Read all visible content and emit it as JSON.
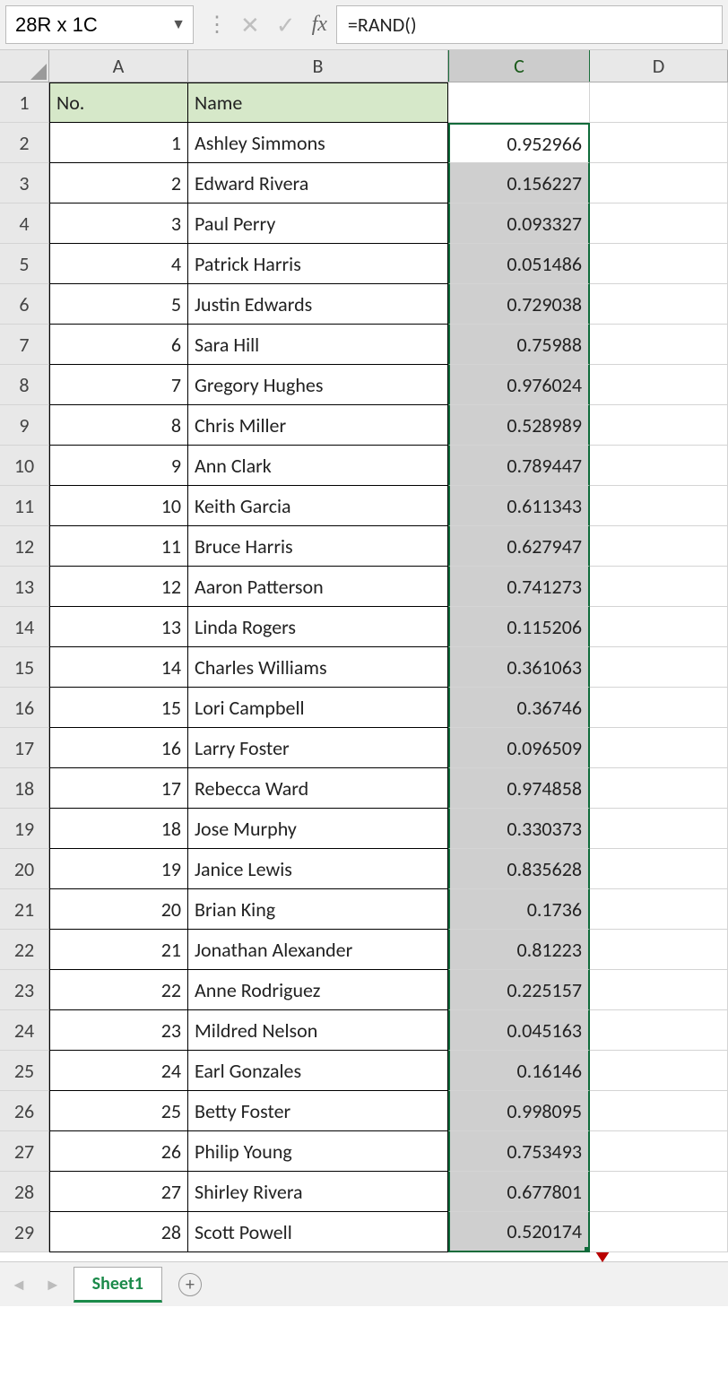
{
  "formula_bar": {
    "name_box": "28R x 1C",
    "fx_label": "fx",
    "formula": "=RAND()"
  },
  "columns": [
    "A",
    "B",
    "C",
    "D"
  ],
  "selected_column": "C",
  "header_row": {
    "A": "No.",
    "B": "Name",
    "C": ""
  },
  "rows": [
    {
      "r": 1,
      "A": "No.",
      "B": "Name",
      "C": ""
    },
    {
      "r": 2,
      "A": "1",
      "B": "Ashley Simmons",
      "C": "0.952966"
    },
    {
      "r": 3,
      "A": "2",
      "B": "Edward Rivera",
      "C": "0.156227"
    },
    {
      "r": 4,
      "A": "3",
      "B": "Paul Perry",
      "C": "0.093327"
    },
    {
      "r": 5,
      "A": "4",
      "B": "Patrick Harris",
      "C": "0.051486"
    },
    {
      "r": 6,
      "A": "5",
      "B": "Justin Edwards",
      "C": "0.729038"
    },
    {
      "r": 7,
      "A": "6",
      "B": "Sara Hill",
      "C": "0.75988"
    },
    {
      "r": 8,
      "A": "7",
      "B": "Gregory Hughes",
      "C": "0.976024"
    },
    {
      "r": 9,
      "A": "8",
      "B": "Chris Miller",
      "C": "0.528989"
    },
    {
      "r": 10,
      "A": "9",
      "B": "Ann Clark",
      "C": "0.789447"
    },
    {
      "r": 11,
      "A": "10",
      "B": "Keith Garcia",
      "C": "0.611343"
    },
    {
      "r": 12,
      "A": "11",
      "B": "Bruce Harris",
      "C": "0.627947"
    },
    {
      "r": 13,
      "A": "12",
      "B": "Aaron Patterson",
      "C": "0.741273"
    },
    {
      "r": 14,
      "A": "13",
      "B": "Linda Rogers",
      "C": "0.115206"
    },
    {
      "r": 15,
      "A": "14",
      "B": "Charles Williams",
      "C": "0.361063"
    },
    {
      "r": 16,
      "A": "15",
      "B": "Lori Campbell",
      "C": "0.36746"
    },
    {
      "r": 17,
      "A": "16",
      "B": "Larry Foster",
      "C": "0.096509"
    },
    {
      "r": 18,
      "A": "17",
      "B": "Rebecca Ward",
      "C": "0.974858"
    },
    {
      "r": 19,
      "A": "18",
      "B": "Jose Murphy",
      "C": "0.330373"
    },
    {
      "r": 20,
      "A": "19",
      "B": "Janice Lewis",
      "C": "0.835628"
    },
    {
      "r": 21,
      "A": "20",
      "B": "Brian King",
      "C": "0.1736"
    },
    {
      "r": 22,
      "A": "21",
      "B": "Jonathan Alexander",
      "C": "0.81223"
    },
    {
      "r": 23,
      "A": "22",
      "B": "Anne Rodriguez",
      "C": "0.225157"
    },
    {
      "r": 24,
      "A": "23",
      "B": "Mildred Nelson",
      "C": "0.045163"
    },
    {
      "r": 25,
      "A": "24",
      "B": "Earl Gonzales",
      "C": "0.16146"
    },
    {
      "r": 26,
      "A": "25",
      "B": "Betty Foster",
      "C": "0.998095"
    },
    {
      "r": 27,
      "A": "26",
      "B": "Philip Young",
      "C": "0.753493"
    },
    {
      "r": 28,
      "A": "27",
      "B": "Shirley Rivera",
      "C": "0.677801"
    },
    {
      "r": 29,
      "A": "28",
      "B": "Scott Powell",
      "C": "0.520174"
    }
  ],
  "sheet_tab": "Sheet1"
}
